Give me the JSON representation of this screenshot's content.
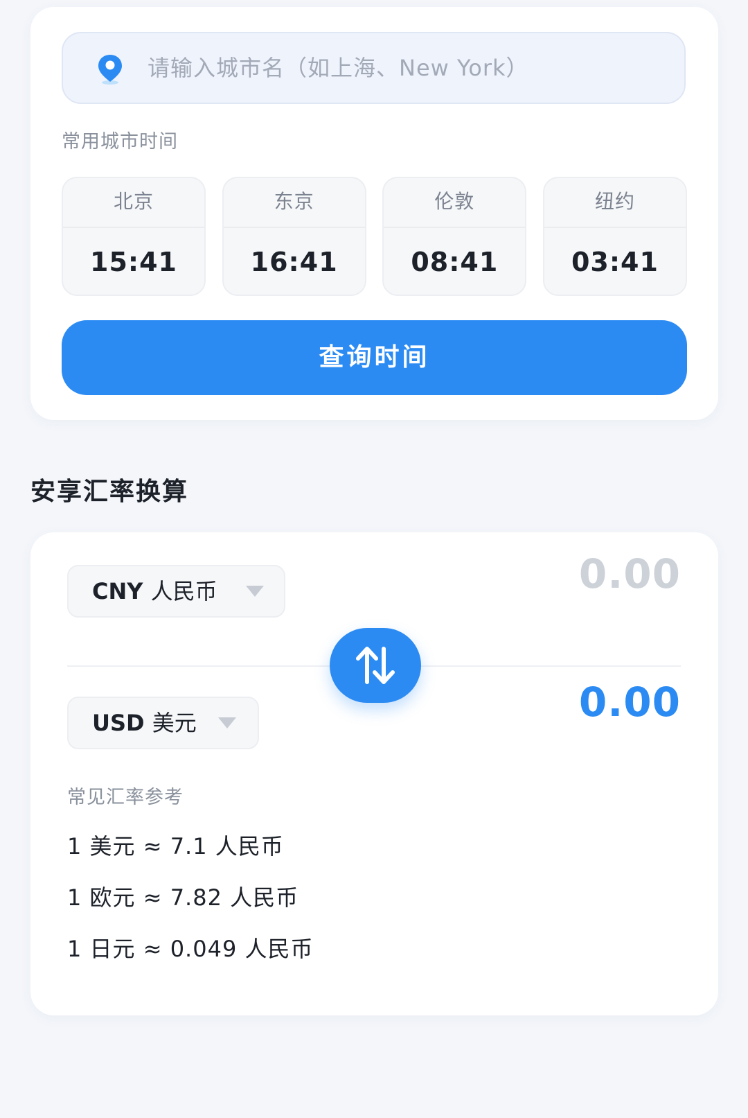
{
  "time": {
    "search": {
      "icon": "location-pin-icon",
      "placeholder": "请输入城市名（如上海、New York）"
    },
    "common_label": "常用城市时间",
    "cities": [
      {
        "name": "北京",
        "time": "15:41"
      },
      {
        "name": "东京",
        "time": "16:41"
      },
      {
        "name": "伦敦",
        "time": "08:41"
      },
      {
        "name": "纽约",
        "time": "03:41"
      }
    ],
    "query_label": "查询时间"
  },
  "fx": {
    "title": "安享汇率换算",
    "from": {
      "code": "CNY",
      "name": "人民币",
      "amount": "0.00"
    },
    "to": {
      "code": "USD",
      "name": "美元",
      "amount": "0.00"
    },
    "swap_icon": "swap-arrows-icon",
    "reference_label": "常见汇率参考",
    "rates": [
      "1 美元 ≈ 7.1 人民币",
      "1 欧元 ≈ 7.82 人民币",
      "1 日元 ≈ 0.049 人民币"
    ]
  },
  "colors": {
    "accent": "#2b8bf3",
    "page_bg": "#f4f6fa",
    "placeholder_amount": "#c9ced6"
  }
}
